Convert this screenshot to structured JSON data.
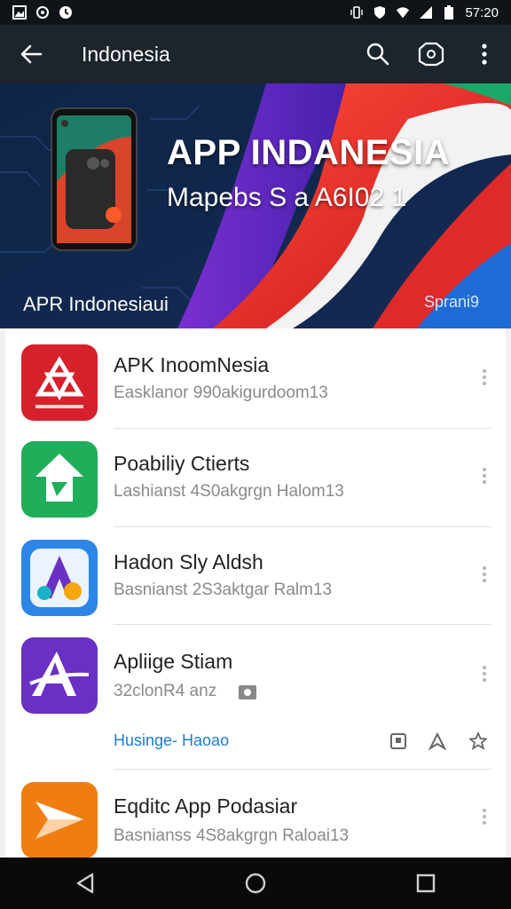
{
  "status_bar": {
    "time": "57:20",
    "left_icons": [
      "image-icon",
      "sync-icon",
      "clock-icon"
    ],
    "right_icons": [
      "vibrate-icon",
      "shield-icon",
      "wifi-icon",
      "signal-icon",
      "battery-icon"
    ]
  },
  "app_bar": {
    "title": "Indonesia",
    "actions": [
      "search-icon",
      "camera-icon",
      "more-vert-icon"
    ]
  },
  "banner": {
    "title": "APP INDANESIA",
    "subtitle": "Mapebs S a A6I02 1",
    "caption": "APR Indonesiaui",
    "link": "Sprani9"
  },
  "apps": [
    {
      "name": "APK InoomNesia",
      "meta": "Easklanor 990akigurdoom13",
      "icon": "red-app-icon",
      "color": "#d6202b"
    },
    {
      "name": "Poabiliy Ctierts",
      "meta": "Lashianst 4S0akgrgn Halom13",
      "icon": "green-app-icon",
      "color": "#1fae5a"
    },
    {
      "name": "Hadon Sly Aldsh",
      "meta": "Basnianst 2S3aktgar Ralm13",
      "icon": "blue-app-icon",
      "color": "#2c86e8"
    },
    {
      "name": "Apliige Stiam",
      "meta": "32clonR4  anz",
      "icon": "purple-app-icon",
      "color": "#6a2fc4",
      "sub_link": "Husinge- Haoao",
      "actions": [
        "bookmark-icon",
        "expand-icon",
        "star-icon"
      ]
    },
    {
      "name": "Eqditc App Podasiar",
      "meta": "Basnianss 4S8akgrgn Raloai13",
      "icon": "orange-app-icon",
      "color": "#f07d12"
    }
  ],
  "nav_bar": [
    "back-triangle-icon",
    "home-circle-icon",
    "recents-square-icon"
  ]
}
